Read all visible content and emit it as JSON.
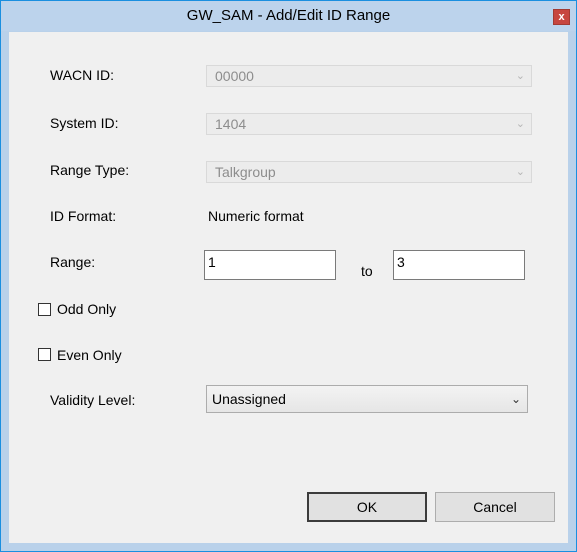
{
  "window": {
    "title": "GW_SAM - Add/Edit ID Range",
    "close_glyph": "x"
  },
  "form": {
    "wacn": {
      "label": "WACN ID:",
      "value": "00000"
    },
    "system": {
      "label": "System ID:",
      "value": "1404"
    },
    "range_type": {
      "label": "Range Type:",
      "value": "Talkgroup"
    },
    "id_format": {
      "label": "ID Format:",
      "value": "Numeric format"
    },
    "range": {
      "label": "Range:",
      "from": "1",
      "to_label": "to",
      "to": "3"
    },
    "odd_only": {
      "label": "Odd Only",
      "checked": false
    },
    "even_only": {
      "label": "Even Only",
      "checked": false
    },
    "validity": {
      "label": "Validity Level:",
      "value": "Unassigned"
    }
  },
  "buttons": {
    "ok": "OK",
    "cancel": "Cancel"
  },
  "icons": {
    "dropdown": "chevron-down-icon",
    "close": "close-icon"
  }
}
